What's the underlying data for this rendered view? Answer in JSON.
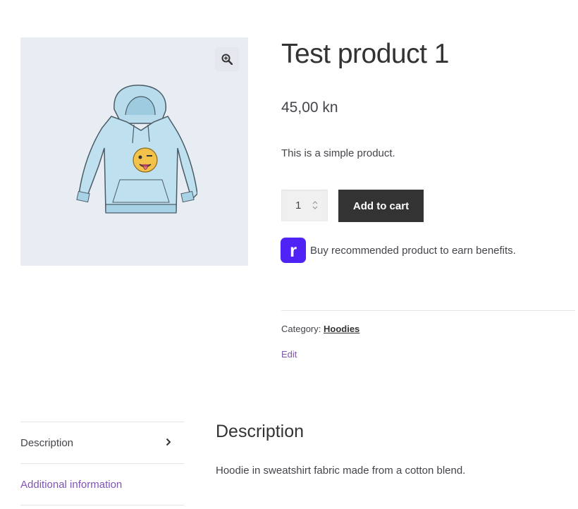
{
  "product": {
    "title": "Test product 1",
    "price": "45,00 kn",
    "short_description": "This is a simple product.",
    "quantity": "1",
    "add_to_cart_label": "Add to cart",
    "category_label": "Category:",
    "category_value": "Hoodies",
    "edit_label": "Edit"
  },
  "reward": {
    "logo_letter": "r",
    "text": "Buy recommended product to earn benefits.",
    "brand_color": "#4f22f6"
  },
  "tabs": [
    {
      "label": "Description"
    },
    {
      "label": "Additional information"
    }
  ],
  "panel": {
    "title": "Description",
    "text": "Hoodie in sweatshirt fabric made from a cotton blend."
  },
  "colors": {
    "accent": "#7f54b3",
    "button": "#333333"
  },
  "icons": {
    "zoom": "magnifier-plus-icon",
    "tab_arrow": "chevron-right-icon"
  }
}
